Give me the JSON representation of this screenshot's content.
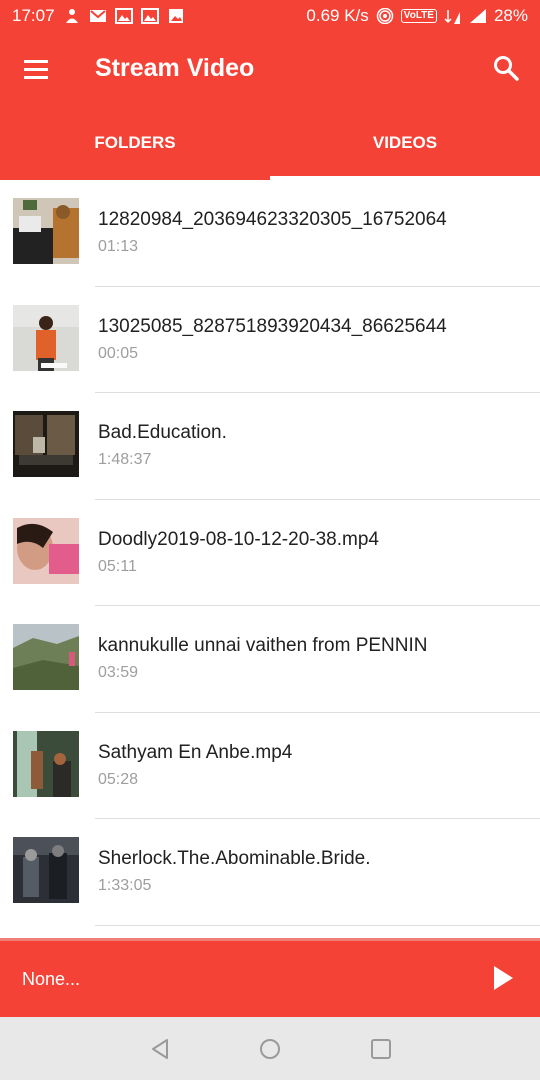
{
  "status_bar": {
    "time": "17:07",
    "speed": "0.69 K/s",
    "volte": "VoLTE",
    "battery": "28%",
    "icons": [
      "person-icon",
      "gmail-icon",
      "gallery-icon",
      "gallery-icon",
      "image-icon",
      "hotspot-icon",
      "4g-icon",
      "signal-icon",
      "signal-icon"
    ]
  },
  "app_bar": {
    "title": "Stream Video",
    "menu_icon": "menu-icon",
    "search_icon": "search-icon"
  },
  "tabs": [
    {
      "label": "FOLDERS",
      "active": false
    },
    {
      "label": "VIDEOS",
      "active": true
    }
  ],
  "videos": [
    {
      "name": "12820984_203694623320305_16752064",
      "duration": "01:13"
    },
    {
      "name": "13025085_828751893920434_86625644",
      "duration": "00:05"
    },
    {
      "name": "Bad.Education.",
      "duration": "1:48:37"
    },
    {
      "name": "Doodly2019-08-10-12-20-38.mp4",
      "duration": "05:11"
    },
    {
      "name": "kannukulle unnai vaithen  from PENNIN",
      "duration": "03:59"
    },
    {
      "name": "Sathyam En Anbe.mp4",
      "duration": "05:28"
    },
    {
      "name": "Sherlock.The.Abominable.Bride.",
      "duration": "1:33:05"
    }
  ],
  "player": {
    "now_playing": "None...",
    "play_icon": "play-icon"
  },
  "colors": {
    "accent": "#f44336",
    "text_primary": "#212121",
    "text_secondary": "#9e9e9e",
    "nav_bar": "#e8e8e8"
  }
}
